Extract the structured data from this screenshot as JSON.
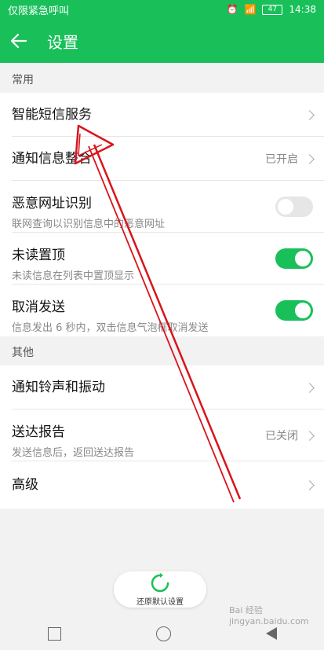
{
  "status_bar": {
    "carrier": "仅限紧急呼叫",
    "battery": "47",
    "time": "14:38"
  },
  "header": {
    "title": "设置"
  },
  "sections": {
    "common": {
      "title": "常用"
    },
    "other": {
      "title": "其他"
    }
  },
  "items": {
    "smart_sms": {
      "label": "智能短信服务"
    },
    "notify_merge": {
      "label": "通知信息整合",
      "value": "已开启"
    },
    "malicious_url": {
      "label": "恶意网址识别",
      "desc": "联网查询以识别信息中的恶意网址",
      "enabled": false
    },
    "unread_top": {
      "label": "未读置顶",
      "desc": "未读信息在列表中置顶显示",
      "enabled": true
    },
    "cancel_send": {
      "label": "取消发送",
      "desc": "信息发出 6 秒内，双击信息气泡框取消发送",
      "enabled": true
    },
    "ringtone": {
      "label": "通知铃声和振动"
    },
    "delivery_report": {
      "label": "送达报告",
      "desc": "发送信息后，返回送达报告",
      "value": "已关闭"
    },
    "advanced": {
      "label": "高级"
    }
  },
  "restore_button": {
    "label": "还原默认设置"
  },
  "watermark": "Bai 经验 jingyan.baidu.com",
  "colors": {
    "accent": "#19c05a",
    "annotation_arrow": "#d9141b"
  }
}
